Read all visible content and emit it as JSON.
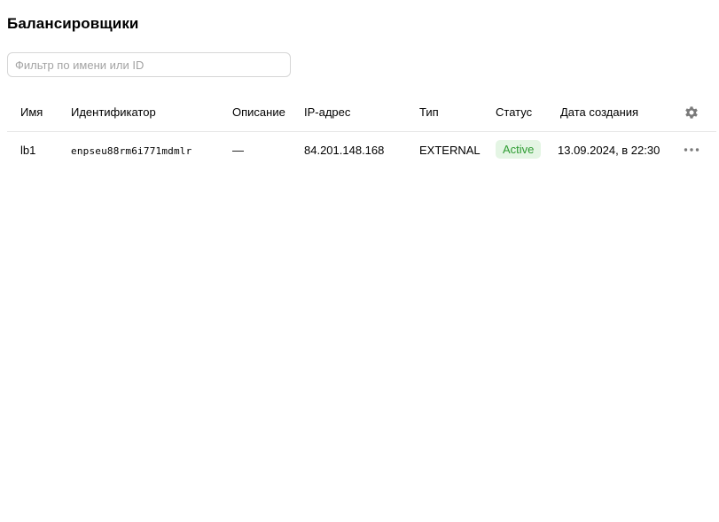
{
  "page": {
    "title": "Балансировщики"
  },
  "filter": {
    "placeholder": "Фильтр по имени или ID",
    "value": ""
  },
  "table": {
    "columns": [
      "Имя",
      "Идентификатор",
      "Описание",
      "IP-адрес",
      "Тип",
      "Статус",
      "Дата создания"
    ],
    "settings_icon": "gear-icon",
    "rows": [
      {
        "name": "lb1",
        "id": "enpseu88rm6i771mdmlr",
        "description": "—",
        "ip": "84.201.148.168",
        "type": "EXTERNAL",
        "status": "Active",
        "created": "13.09.2024, в 22:30",
        "actions_icon": "more-horizontal-icon"
      }
    ]
  },
  "colors": {
    "status_active_text": "#2e9c32",
    "status_active_bg": "#e4f5e4",
    "divider": "#e6e6e6",
    "icon": "#7a7a7a"
  }
}
